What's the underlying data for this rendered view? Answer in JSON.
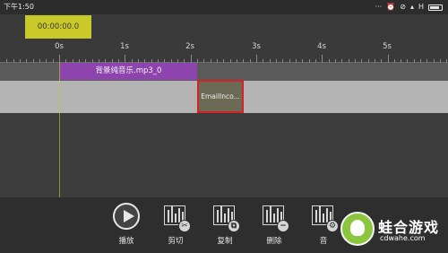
{
  "status_bar": {
    "time": "下午1:50",
    "network_type": "H",
    "icons": [
      "ellipsis-icon",
      "alarm-icon",
      "wifi-off-icon",
      "signal-icon",
      "battery-icon"
    ]
  },
  "timeline": {
    "current_time": "00:00:00.0",
    "ruler_labels": [
      "0s",
      "1s",
      "2s",
      "3s",
      "4s",
      "5s"
    ],
    "music_clip_name": "背景纯音乐.mp3_0",
    "overlay_clip_name": "EmailInco..."
  },
  "toolbar": {
    "play_label": "播放",
    "cut_label": "剪切",
    "copy_label": "复制",
    "delete_label": "删除",
    "volume_label": "音"
  },
  "watermark": {
    "brand": "蛙合游戏",
    "url": "cdwahe.com"
  },
  "colors": {
    "time_display_bg": "#c9c92a",
    "music_clip": "#8e44ad",
    "selected_border": "#d82222",
    "logo_green": "#8cc63f"
  }
}
